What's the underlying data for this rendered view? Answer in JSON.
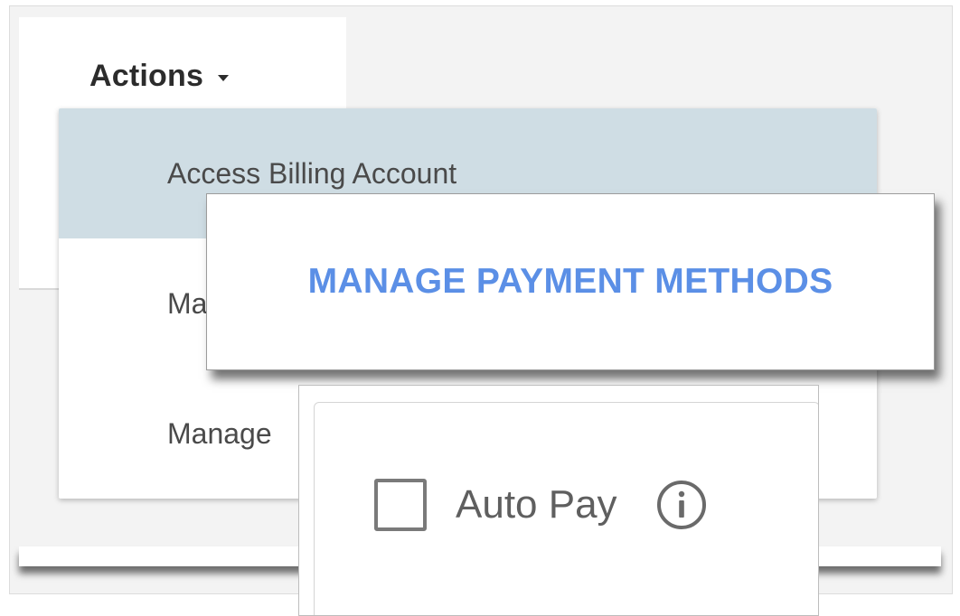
{
  "actions": {
    "label": "Actions",
    "caret_icon": "caret-down-icon"
  },
  "menu": {
    "items": [
      {
        "label": "Access Billing Account",
        "highlighted": true
      },
      {
        "label": "Ma",
        "highlighted": false
      },
      {
        "label": "Manage",
        "highlighted": false
      }
    ],
    "highlight_color": "#cfdde4"
  },
  "payment_callout": {
    "link_label": "MANAGE PAYMENT METHODS",
    "link_color": "#5b8fe6"
  },
  "autopay_callout": {
    "checkbox_label": "Auto Pay",
    "checked": false,
    "info_icon": "info-icon"
  }
}
